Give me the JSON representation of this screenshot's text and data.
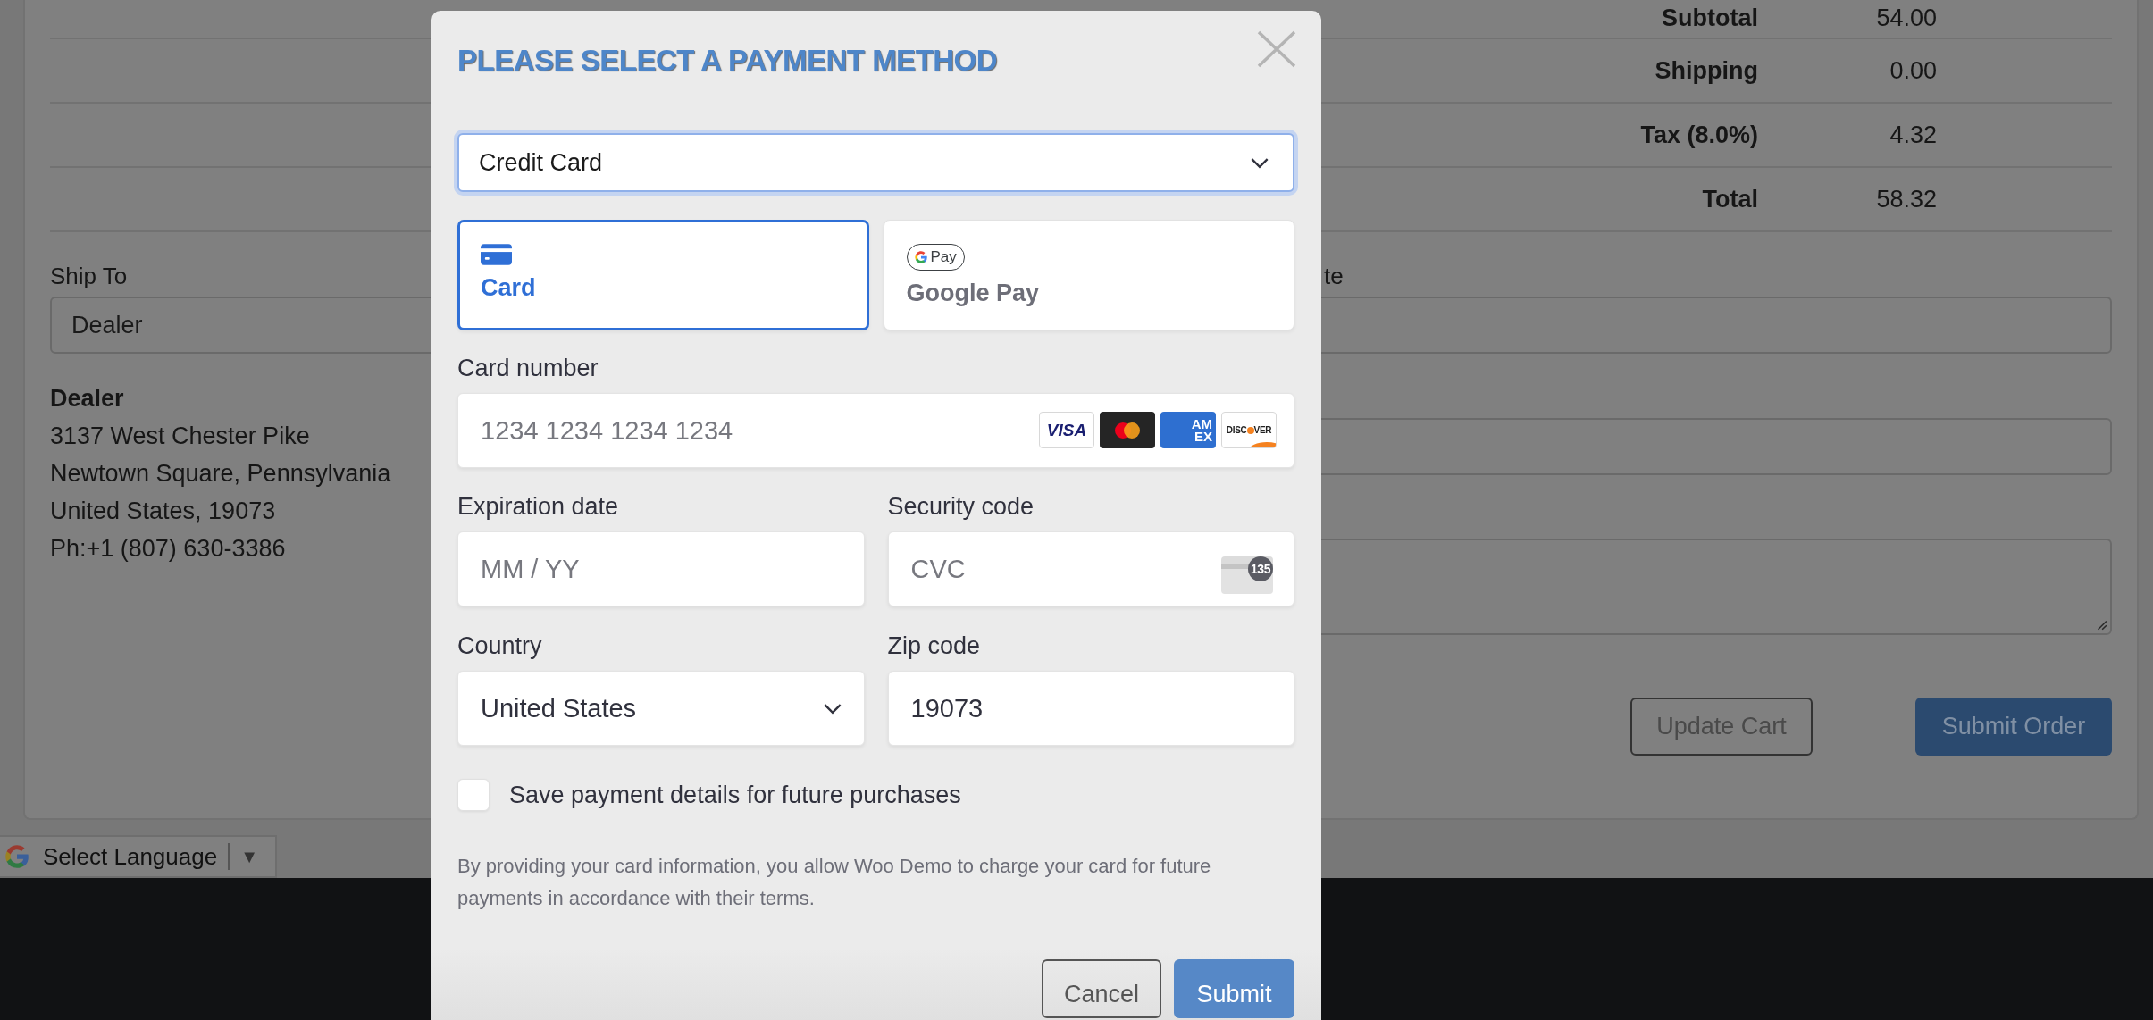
{
  "page": {
    "summary_rows": [
      {
        "label": "Subtotal",
        "value": "54.00"
      },
      {
        "label": "Shipping",
        "value": "0.00"
      },
      {
        "label": "Tax (8.0%)",
        "value": "4.32"
      },
      {
        "label": "Total",
        "value": "58.32"
      }
    ],
    "ship_to": {
      "label": "Ship To",
      "value": "Dealer"
    },
    "address": {
      "name": "Dealer",
      "lines": [
        "3137 West Chester Pike",
        "Newtown Square, Pennsylvania",
        "United States, 19073",
        "Ph:+1 (807) 630-3386"
      ]
    },
    "right_form": {
      "label_fragment": "te"
    },
    "buttons": [
      {
        "label": "Update Cart",
        "kind": "outline"
      },
      {
        "label": "Submit Order",
        "kind": "primary"
      }
    ]
  },
  "language_selector": {
    "label": "Select Language",
    "arrow": "▼"
  },
  "modal": {
    "title": "PLEASE SELECT A PAYMENT METHOD",
    "method_select": {
      "value": "Credit Card"
    },
    "payment_tabs": [
      {
        "kind": "card",
        "label": "Card",
        "selected": true
      },
      {
        "kind": "gpay",
        "label": "Google Pay",
        "badge": "Pay",
        "selected": false
      }
    ],
    "card_number": {
      "label": "Card number",
      "placeholder": "1234 1234 1234 1234",
      "brands": [
        {
          "kind": "visa",
          "text": "VISA"
        },
        {
          "kind": "mastercard"
        },
        {
          "kind": "amex",
          "text_lines": [
            "AM",
            "EX"
          ]
        },
        {
          "kind": "discover",
          "text_parts": [
            "DISC",
            "VER"
          ]
        }
      ]
    },
    "expiration": {
      "label": "Expiration date",
      "placeholder": "MM / YY"
    },
    "security_code": {
      "label": "Security code",
      "placeholder": "CVC",
      "hint": "135"
    },
    "country": {
      "label": "Country",
      "value": "United States"
    },
    "zip": {
      "label": "Zip code",
      "value": "19073"
    },
    "save_details": {
      "label": "Save payment details for future purchases",
      "checked": false
    },
    "disclaimer": "By providing your card information, you allow Woo Demo to charge your card for future payments in accordance with their terms.",
    "buttons": [
      {
        "label": "Cancel",
        "kind": "secondary"
      },
      {
        "label": "Submit",
        "kind": "primary"
      }
    ]
  }
}
